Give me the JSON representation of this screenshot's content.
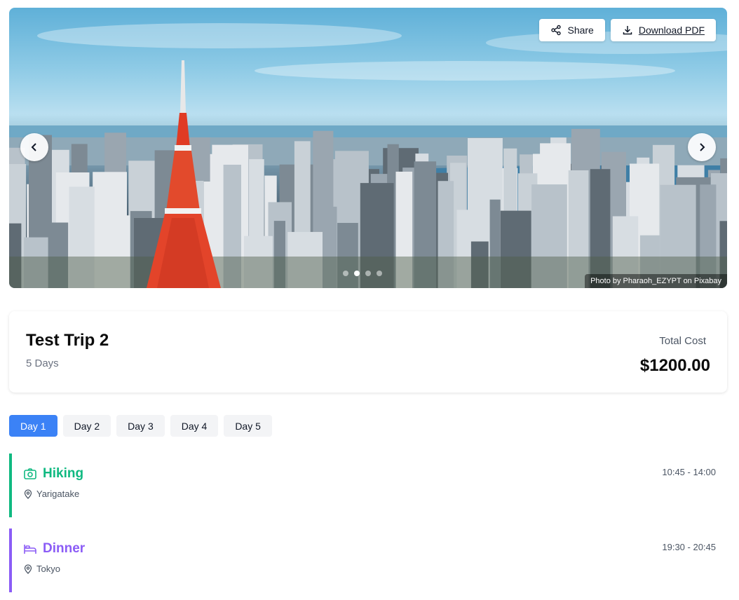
{
  "hero": {
    "share_label": "Share",
    "download_label": "Download PDF",
    "credit": "Photo by Pharaoh_EZYPT on Pixabay",
    "slide_count": 4,
    "active_slide": 1
  },
  "trip": {
    "title": "Test Trip 2",
    "days": "5 Days",
    "cost_label": "Total Cost",
    "cost_value": "$1200.00"
  },
  "tabs": [
    {
      "label": "Day 1",
      "active": true
    },
    {
      "label": "Day 2",
      "active": false
    },
    {
      "label": "Day 3",
      "active": false
    },
    {
      "label": "Day 4",
      "active": false
    },
    {
      "label": "Day 5",
      "active": false
    }
  ],
  "activities": [
    {
      "title": "Hiking",
      "location": "Yarigatake",
      "time": "10:45 - 14:00",
      "icon": "camera-icon",
      "color": "#10b981"
    },
    {
      "title": "Dinner",
      "location": "Tokyo",
      "time": "19:30 - 20:45",
      "icon": "bed-icon",
      "color": "#8b5cf6"
    }
  ],
  "colors": {
    "accent": "#3b82f6",
    "activity_green": "#10b981",
    "activity_purple": "#8b5cf6"
  }
}
